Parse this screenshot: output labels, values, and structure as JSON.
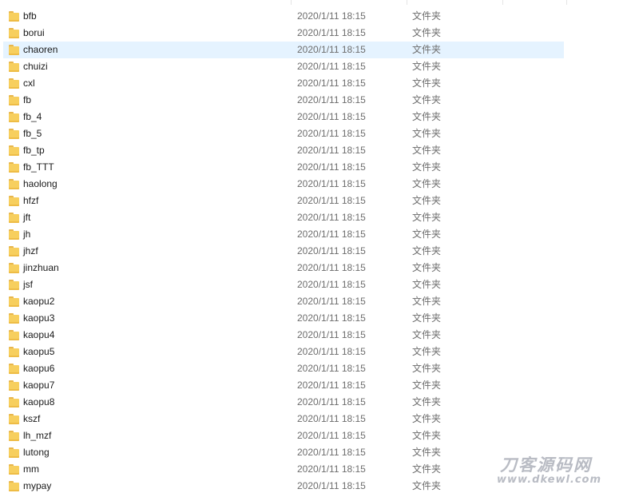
{
  "files": [
    {
      "name": "bfb",
      "date": "2020/1/11 18:15",
      "type": "文件夹",
      "icon": "folder-icon"
    },
    {
      "name": "borui",
      "date": "2020/1/11 18:15",
      "type": "文件夹",
      "icon": "folder-icon"
    },
    {
      "name": "chaoren",
      "date": "2020/1/11 18:15",
      "type": "文件夹",
      "icon": "folder-icon",
      "selected": true
    },
    {
      "name": "chuizi",
      "date": "2020/1/11 18:15",
      "type": "文件夹",
      "icon": "folder-icon"
    },
    {
      "name": "cxl",
      "date": "2020/1/11 18:15",
      "type": "文件夹",
      "icon": "folder-icon"
    },
    {
      "name": "fb",
      "date": "2020/1/11 18:15",
      "type": "文件夹",
      "icon": "folder-icon"
    },
    {
      "name": "fb_4",
      "date": "2020/1/11 18:15",
      "type": "文件夹",
      "icon": "folder-icon"
    },
    {
      "name": "fb_5",
      "date": "2020/1/11 18:15",
      "type": "文件夹",
      "icon": "folder-icon"
    },
    {
      "name": "fb_tp",
      "date": "2020/1/11 18:15",
      "type": "文件夹",
      "icon": "folder-icon"
    },
    {
      "name": "fb_TTT",
      "date": "2020/1/11 18:15",
      "type": "文件夹",
      "icon": "folder-icon"
    },
    {
      "name": "haolong",
      "date": "2020/1/11 18:15",
      "type": "文件夹",
      "icon": "folder-icon"
    },
    {
      "name": "hfzf",
      "date": "2020/1/11 18:15",
      "type": "文件夹",
      "icon": "folder-icon"
    },
    {
      "name": "jft",
      "date": "2020/1/11 18:15",
      "type": "文件夹",
      "icon": "folder-icon"
    },
    {
      "name": "jh",
      "date": "2020/1/11 18:15",
      "type": "文件夹",
      "icon": "folder-icon"
    },
    {
      "name": "jhzf",
      "date": "2020/1/11 18:15",
      "type": "文件夹",
      "icon": "folder-icon"
    },
    {
      "name": "jinzhuan",
      "date": "2020/1/11 18:15",
      "type": "文件夹",
      "icon": "folder-icon"
    },
    {
      "name": "jsf",
      "date": "2020/1/11 18:15",
      "type": "文件夹",
      "icon": "folder-icon"
    },
    {
      "name": "kaopu2",
      "date": "2020/1/11 18:15",
      "type": "文件夹",
      "icon": "folder-icon"
    },
    {
      "name": "kaopu3",
      "date": "2020/1/11 18:15",
      "type": "文件夹",
      "icon": "folder-icon"
    },
    {
      "name": "kaopu4",
      "date": "2020/1/11 18:15",
      "type": "文件夹",
      "icon": "folder-icon"
    },
    {
      "name": "kaopu5",
      "date": "2020/1/11 18:15",
      "type": "文件夹",
      "icon": "folder-icon"
    },
    {
      "name": "kaopu6",
      "date": "2020/1/11 18:15",
      "type": "文件夹",
      "icon": "folder-icon"
    },
    {
      "name": "kaopu7",
      "date": "2020/1/11 18:15",
      "type": "文件夹",
      "icon": "folder-icon"
    },
    {
      "name": "kaopu8",
      "date": "2020/1/11 18:15",
      "type": "文件夹",
      "icon": "folder-icon"
    },
    {
      "name": "kszf",
      "date": "2020/1/11 18:15",
      "type": "文件夹",
      "icon": "folder-icon"
    },
    {
      "name": "lh_mzf",
      "date": "2020/1/11 18:15",
      "type": "文件夹",
      "icon": "folder-icon"
    },
    {
      "name": "lutong",
      "date": "2020/1/11 18:15",
      "type": "文件夹",
      "icon": "folder-icon"
    },
    {
      "name": "mm",
      "date": "2020/1/11 18:15",
      "type": "文件夹",
      "icon": "folder-icon"
    },
    {
      "name": "mypay",
      "date": "2020/1/11 18:15",
      "type": "文件夹",
      "icon": "folder-icon"
    }
  ],
  "watermark": {
    "title": "刀客源码网",
    "url": "www.dkewl.com"
  }
}
